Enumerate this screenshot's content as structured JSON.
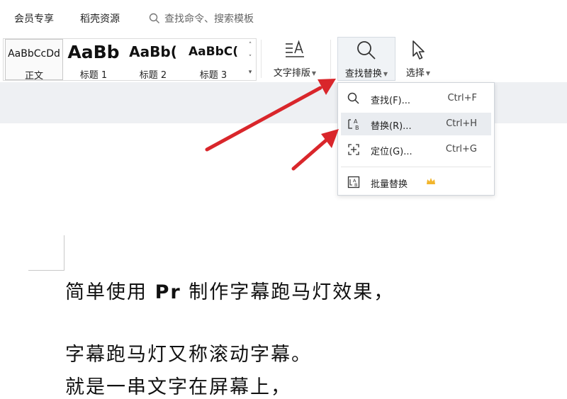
{
  "top_menu": {
    "items": [
      "会员专享",
      "稻壳资源"
    ],
    "search_placeholder": "查找命令、搜索模板"
  },
  "styles_gallery": {
    "items": [
      {
        "sample": "AaBbCcDd",
        "label": "正文"
      },
      {
        "sample": "AaBb",
        "label": "标题 1"
      },
      {
        "sample": "AaBb(",
        "label": "标题 2"
      },
      {
        "sample": "AaBbC(",
        "label": "标题 3"
      }
    ]
  },
  "ribbon": {
    "text_layout_label": "文字排版",
    "find_replace_label": "查找替换",
    "select_label": "选择"
  },
  "dropdown": {
    "items": [
      {
        "label": "查找(F)...",
        "shortcut": "Ctrl+F",
        "icon": "search-icon"
      },
      {
        "label": "替换(R)...",
        "shortcut": "Ctrl+H",
        "icon": "replace-icon"
      },
      {
        "label": "定位(G)...",
        "shortcut": "Ctrl+G",
        "icon": "locate-icon"
      },
      {
        "label": "批量替换",
        "shortcut": "",
        "icon": "batch-replace-icon"
      }
    ]
  },
  "document": {
    "line1_before": "简单使用 ",
    "line1_bold": "Pr",
    "line1_after": " 制作字幕跑马灯效果，",
    "line2": "字幕跑马灯又称滚动字幕。",
    "line3": "就是一串文字在屏幕上，"
  },
  "colors": {
    "arrow": "#d9262b",
    "crown": "#f2b52c",
    "hover": "#e9ecf0",
    "band": "#eef0f3"
  }
}
